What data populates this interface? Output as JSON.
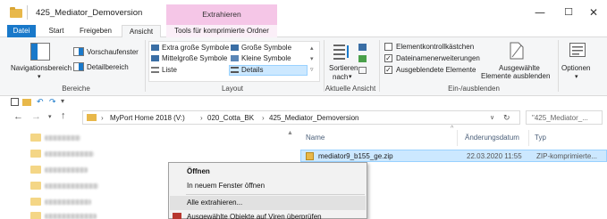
{
  "window": {
    "title": "425_Mediator_Demoversion",
    "context_group": "Extrahieren",
    "controls": {
      "minimize": "—",
      "maximize": "☐",
      "close": "✕"
    }
  },
  "tabs": {
    "file": "Datei",
    "start": "Start",
    "share": "Freigeben",
    "view": "Ansicht",
    "compressed_tools": "Tools für komprimierte Ordner"
  },
  "ribbon": {
    "panes": {
      "label": "Bereiche",
      "nav_pane": "Navigationsbereich",
      "preview": "Vorschaufenster",
      "details": "Detailbereich"
    },
    "layout": {
      "label": "Layout",
      "extra_large": "Extra große Symbole",
      "large": "Große Symbole",
      "medium": "Mittelgroße Symbole",
      "small": "Kleine Symbole",
      "list": "Liste",
      "details": "Details"
    },
    "current_view": {
      "label": "Aktuelle Ansicht",
      "sort_line1": "Sortieren",
      "sort_line2": "nach"
    },
    "show_hide": {
      "label": "Ein-/ausblenden",
      "checkboxes": "Elementkontrollkästchen",
      "extensions": "Dateinamenerweiterungen",
      "hidden": "Ausgeblendete Elemente",
      "hide_selected_line1": "Ausgewählte",
      "hide_selected_line2": "Elemente ausblenden",
      "options": "Optionen"
    }
  },
  "address": {
    "segments": [
      "MyPort Home 2018 (V:)",
      "020_Cotta_BK",
      "425_Mediator_Demoversion"
    ],
    "search_placeholder": "\"425_Mediator_..."
  },
  "file_list": {
    "columns": [
      "Name",
      "Änderungsdatum",
      "Typ"
    ],
    "rows": [
      {
        "name": "mediator9_b155_ge.zip",
        "date": "22.03.2020 11:55",
        "type": "ZIP-komprimierte..."
      }
    ]
  },
  "context_menu": {
    "items": [
      "Öffnen",
      "In neuem Fenster öffnen",
      "Alle extrahieren...",
      "Ausgewählte Objekte auf Viren überprüfen"
    ]
  },
  "colors": {
    "accent": "#1979ca",
    "context_tab": "#f5c6e7",
    "selection": "#cce8ff",
    "folder": "#e8b84a"
  }
}
